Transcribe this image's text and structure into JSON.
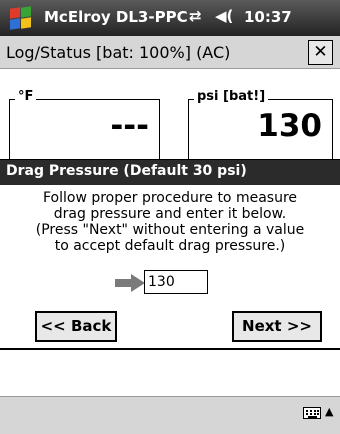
{
  "taskbar": {
    "title": "McElroy DL3-PPC",
    "sync_glyph": "⇄",
    "volume_glyph": "◀(",
    "time": "10:37",
    "start_icon": "windows-flag-icon",
    "colors": {
      "red": "#e03b2a",
      "green": "#3aa335",
      "blue": "#2f6fd6",
      "yellow": "#f2c21b"
    }
  },
  "window": {
    "title": "Log/Status  [bat: 100%] (AC)",
    "close_label": "✕"
  },
  "readouts": {
    "temperature": {
      "label": "°F",
      "value": "---"
    },
    "pressure": {
      "label": "psi [bat!]",
      "value": "130"
    }
  },
  "dialog": {
    "title": "Drag Pressure (Default 30 psi)",
    "lines": [
      "Follow proper procedure to measure",
      "drag pressure and enter it below.",
      "(Press \"Next\" without entering a value",
      "to accept default drag pressure.)"
    ],
    "input_value": "130",
    "back_label": "<< Back",
    "next_label": "Next >>",
    "arrow_icon": "right-arrow-icon",
    "arrow_color": "#7a7a7a"
  },
  "bottom": {
    "keyboard_icon": "keyboard-icon",
    "sip_arrow": "▲"
  }
}
